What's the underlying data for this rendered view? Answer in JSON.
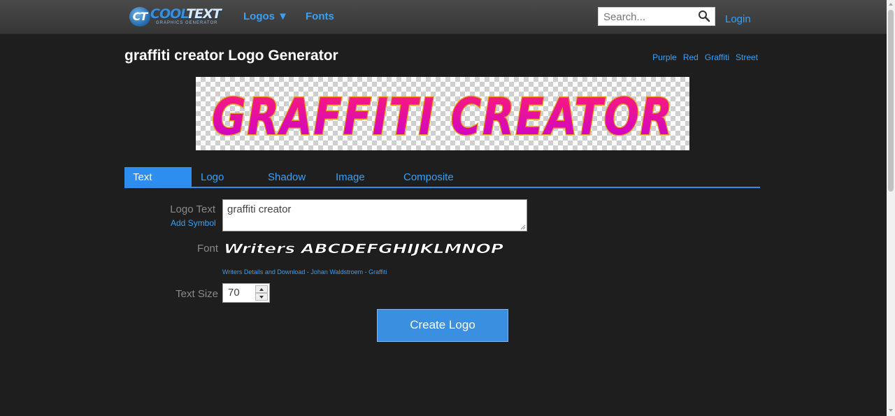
{
  "nav": {
    "logo_text_1": "COOL",
    "logo_text_2": "TEXT",
    "logo_mark": "CT",
    "logo_subtitle": "GRAPHICS GENERATOR",
    "logos_label": "Logos ▼",
    "fonts_label": "Fonts",
    "search_placeholder": "Search...",
    "login_label": "Login"
  },
  "header": {
    "title": "graffiti creator Logo Generator",
    "tags": [
      "Purple",
      "Red",
      "Graffiti",
      "Street"
    ]
  },
  "preview": {
    "logo_text": "GRAFFITI CREATOR",
    "fill_top": "#ff1f6e",
    "fill_bottom": "#c800d8",
    "outline": "#e89a1a"
  },
  "tabs": [
    "Text",
    "Logo",
    "Shadow",
    "Image",
    "Composite"
  ],
  "active_tab": "Text",
  "form": {
    "logo_text_label": "Logo Text",
    "add_symbol_label": "Add Symbol",
    "logo_text_value": "graffiti creator",
    "font_label": "Font",
    "font_preview_text": "Writers ABCDEFGHIJKLMNOP",
    "font_link": "Writers Details and Download - Johan Waldstroem - Graffiti",
    "text_size_label": "Text Size",
    "text_size_value": "70",
    "create_button": "Create Logo"
  },
  "colors": {
    "accent": "#3aa0f5",
    "background": "#1e1e1e"
  }
}
